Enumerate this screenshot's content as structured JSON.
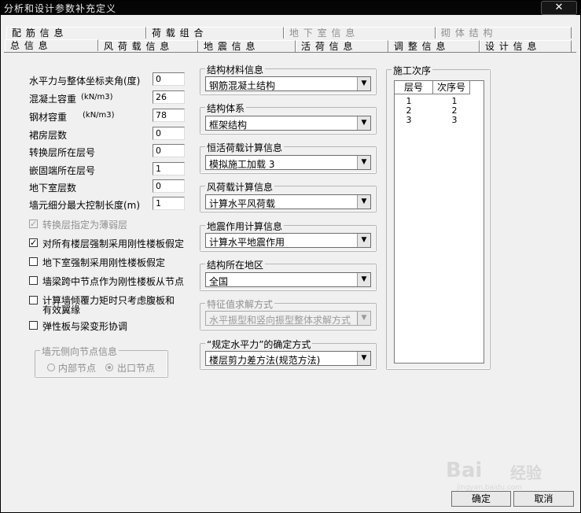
{
  "window": {
    "title": "分析和设计参数补充定义",
    "close_label": "✕"
  },
  "tabs_row1": [
    {
      "label": "配 筋 信 息",
      "disabled": false
    },
    {
      "label": "荷 载 组 合",
      "disabled": false
    },
    {
      "label": "地 下 室 信 息",
      "disabled": true
    },
    {
      "label": "砌 体 结 构",
      "disabled": true
    }
  ],
  "tabs_row2": [
    {
      "label": "总  信  息"
    },
    {
      "label": "风 荷 载 信 息"
    },
    {
      "label": "地 震 信 息"
    },
    {
      "label": "活 荷 信 息"
    },
    {
      "label": "调 整 信 息"
    },
    {
      "label": "设 计 信 息"
    }
  ],
  "params": [
    {
      "label": "水平力与整体坐标夹角(度)",
      "value": "0"
    },
    {
      "label": "混凝土容重",
      "unit": "(kN/m3)",
      "value": "26"
    },
    {
      "label": "钢材容重",
      "unit": "(kN/m3)",
      "value": "78"
    },
    {
      "label": "裙房层数",
      "value": "0"
    },
    {
      "label": "转换层所在层号",
      "value": "0"
    },
    {
      "label": "嵌固端所在层号",
      "value": "1"
    },
    {
      "label": "地下室层数",
      "value": "0"
    },
    {
      "label": "墙元细分最大控制长度(m)",
      "value": "1"
    }
  ],
  "checks": [
    {
      "label": "转换层指定为薄弱层",
      "checked": true,
      "disabled": true
    },
    {
      "label": "对所有楼层强制采用刚性楼板假定",
      "checked": true,
      "disabled": false
    },
    {
      "label": "地下室强制采用刚性楼板假定",
      "checked": false,
      "disabled": false
    },
    {
      "label": "墙梁跨中节点作为刚性楼板从节点",
      "checked": false,
      "disabled": false
    },
    {
      "label": "计算墙倾覆力矩时只考虑腹板和",
      "label2": "有效翼缘",
      "checked": false,
      "disabled": false
    },
    {
      "label": "弹性板与梁变形协调",
      "checked": false,
      "disabled": false
    }
  ],
  "wall_node": {
    "title": "墙元侧向节点信息",
    "options": [
      {
        "label": "内部节点",
        "selected": false
      },
      {
        "label": "出口节点",
        "selected": true
      }
    ]
  },
  "groups": [
    {
      "title": "结构材料信息",
      "value": "钢筋混凝土结构",
      "disabled": false
    },
    {
      "title": "结构体系",
      "value": "框架结构",
      "disabled": false
    },
    {
      "title": "恒活荷载计算信息",
      "value": "模拟施工加载 3",
      "disabled": false
    },
    {
      "title": "风荷载计算信息",
      "value": "计算水平风荷载",
      "disabled": false
    },
    {
      "title": "地震作用计算信息",
      "value": "计算水平地震作用",
      "disabled": false
    },
    {
      "title": "结构所在地区",
      "value": "全国",
      "disabled": false
    },
    {
      "title": "特征值求解方式",
      "value": "水平振型和竖向振型整体求解方式",
      "disabled": true
    },
    {
      "title": "“规定水平力”的确定方式",
      "value": "楼层剪力差方法(规范方法)",
      "disabled": false
    }
  ],
  "construction": {
    "title": "施工次序",
    "headers": [
      "层号",
      "次序号"
    ],
    "rows": [
      [
        "1",
        "1"
      ],
      [
        "2",
        "2"
      ],
      [
        "3",
        "3"
      ]
    ]
  },
  "buttons": {
    "ok": "确定",
    "cancel": "取消"
  },
  "watermark": {
    "main": "Bai",
    "mid": "经验",
    "sub": "jingyan.baidu.com"
  }
}
